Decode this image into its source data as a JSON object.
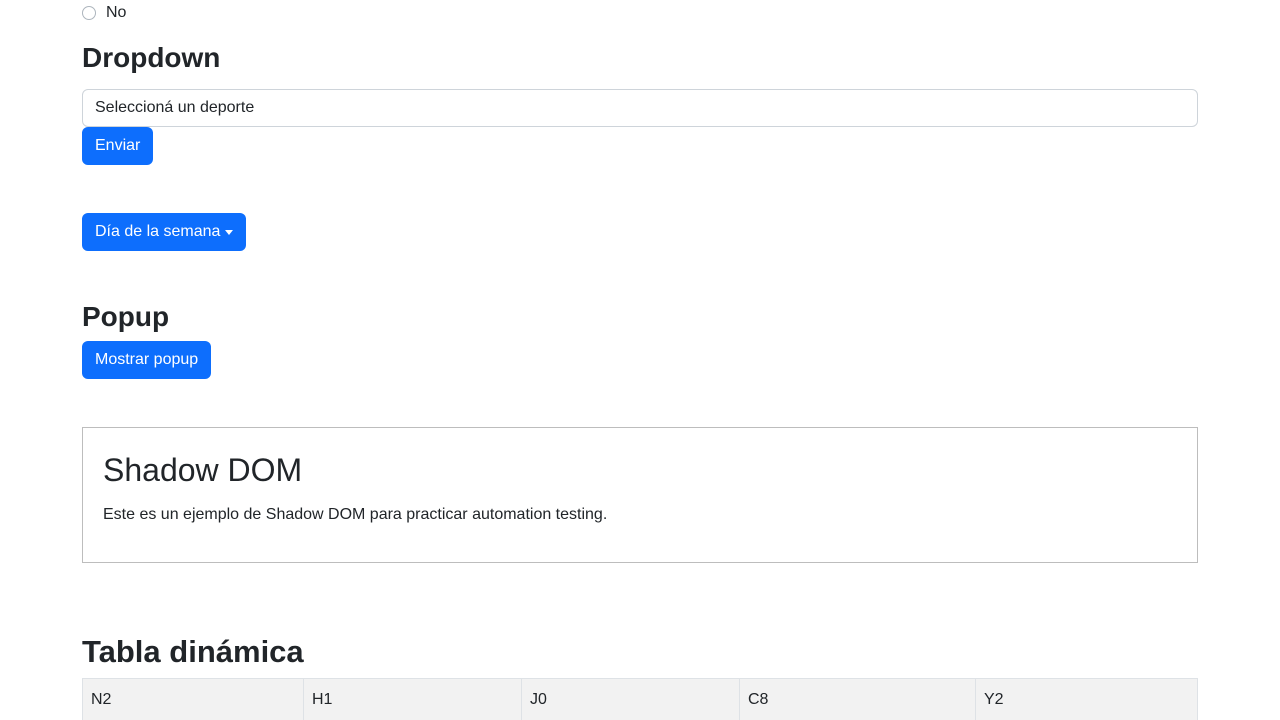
{
  "radio": {
    "label": "No"
  },
  "dropdown": {
    "heading": "Dropdown",
    "select_value": "Seleccioná un deporte",
    "submit_label": "Enviar",
    "weekday_label": "Día de la semana"
  },
  "popup": {
    "heading": "Popup",
    "button_label": "Mostrar popup"
  },
  "shadow_dom": {
    "heading": "Shadow DOM",
    "text": "Este es un ejemplo de Shadow DOM para practicar automation testing."
  },
  "table": {
    "heading": "Tabla dinámica",
    "row": [
      "N2",
      "H1",
      "J0",
      "C8",
      "Y2"
    ]
  }
}
